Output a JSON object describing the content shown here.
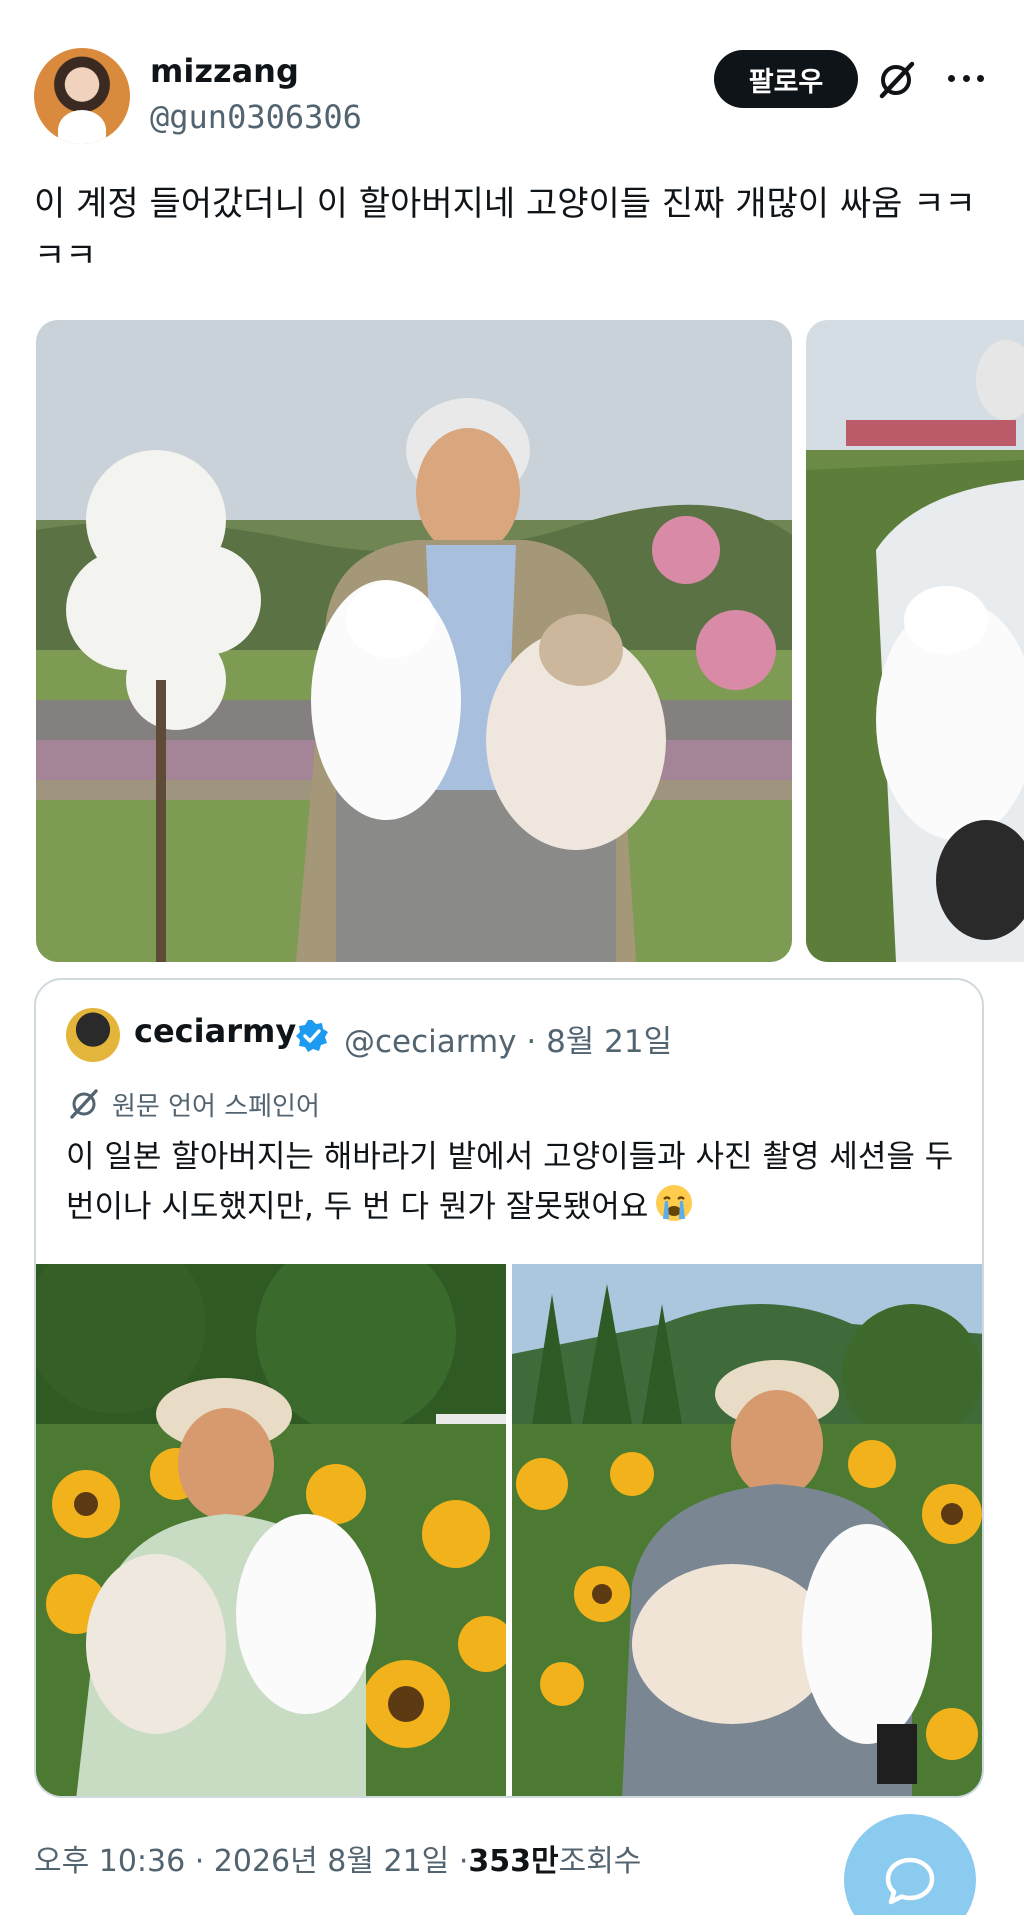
{
  "post": {
    "display_name": "mizzang",
    "handle": "@gun0306306",
    "follow_label": "팔로우",
    "text": "이 계정 들어갔더니 이 할아버지네 고양이들 진짜 개많이 싸움 ㅋㅋㅋㅋ",
    "timestamp": "오후 10:36 · 2026년 8월 21일 · ",
    "views_count": "353만",
    "views_label": " 조회수"
  },
  "quote": {
    "display_name": "ceciarmy",
    "handle_date": "@ceciarmy · 8월 21일",
    "translate_label": "원문 언어 스페인어",
    "text": "이 일본 할아버지는 해바라기 밭에서 고양이들과 사진 촬영 세션을 두 번이나 시도했지만, 두 번 다 뭔가 잘못됐어요"
  },
  "icons": {
    "grok": "grok-icon",
    "more": "more-icon",
    "verified": "verified-badge-icon",
    "translate": "translate-icon",
    "reply": "reply-icon"
  },
  "colors": {
    "verified_blue": "#1d9bf0",
    "reply_fab": "#8ccbf0",
    "secondary_text": "#536471"
  }
}
